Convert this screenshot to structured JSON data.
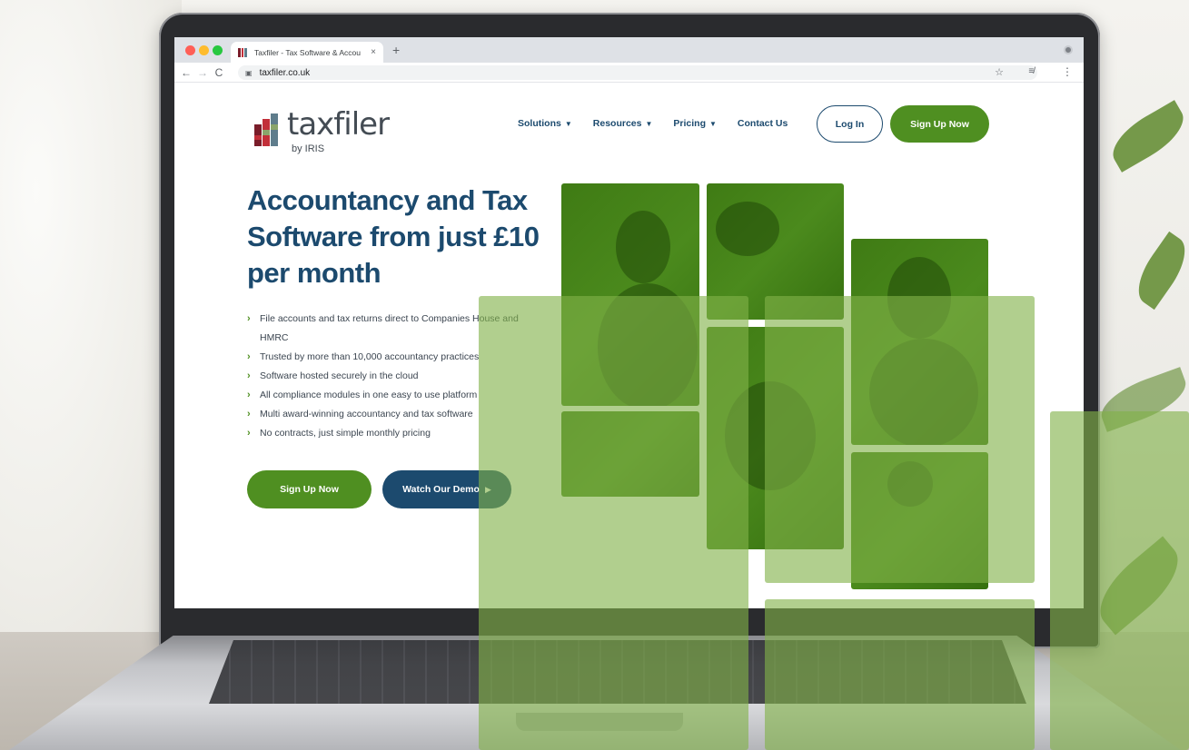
{
  "browser": {
    "tab_title": "Taxfiler - Tax Software & Accou",
    "tab_close": "×",
    "new_tab": "+",
    "url": "taxfiler.co.uk",
    "back": "←",
    "forward": "→",
    "reload": "C",
    "star": "☆",
    "reading_list": "≡/",
    "menu": "⋮",
    "lock": "🔒"
  },
  "logo": {
    "word": "taxfiler",
    "sub": "by IRIS",
    "mark_colors": [
      "#7a1d2a",
      "#c22f39",
      "#5f7d8c",
      "#8aa56b"
    ]
  },
  "nav": {
    "items": [
      {
        "label": "Solutions",
        "caret": "▼"
      },
      {
        "label": "Resources",
        "caret": "▼"
      },
      {
        "label": "Pricing",
        "caret": "▼"
      },
      {
        "label": "Contact Us",
        "caret": ""
      }
    ],
    "login": "Log In",
    "signup": "Sign Up Now"
  },
  "hero": {
    "title": "Accountancy and Tax Software from just £10 per month",
    "chevron": "›",
    "features": [
      "File accounts and tax returns direct to Companies House and HMRC",
      "Trusted by more than 10,000 accountancy practices",
      "Software hosted securely in the cloud",
      "All compliance modules in one easy to use platform",
      "Multi award-winning accountancy and tax software",
      "No contracts, just simple monthly pricing"
    ],
    "signup": "Sign Up Now",
    "demo": "Watch Our Demo",
    "play": "▶"
  },
  "colors": {
    "brand_navy": "#1c4a6e",
    "brand_green": "#4f8f21",
    "overlay_green": "#81b249"
  }
}
